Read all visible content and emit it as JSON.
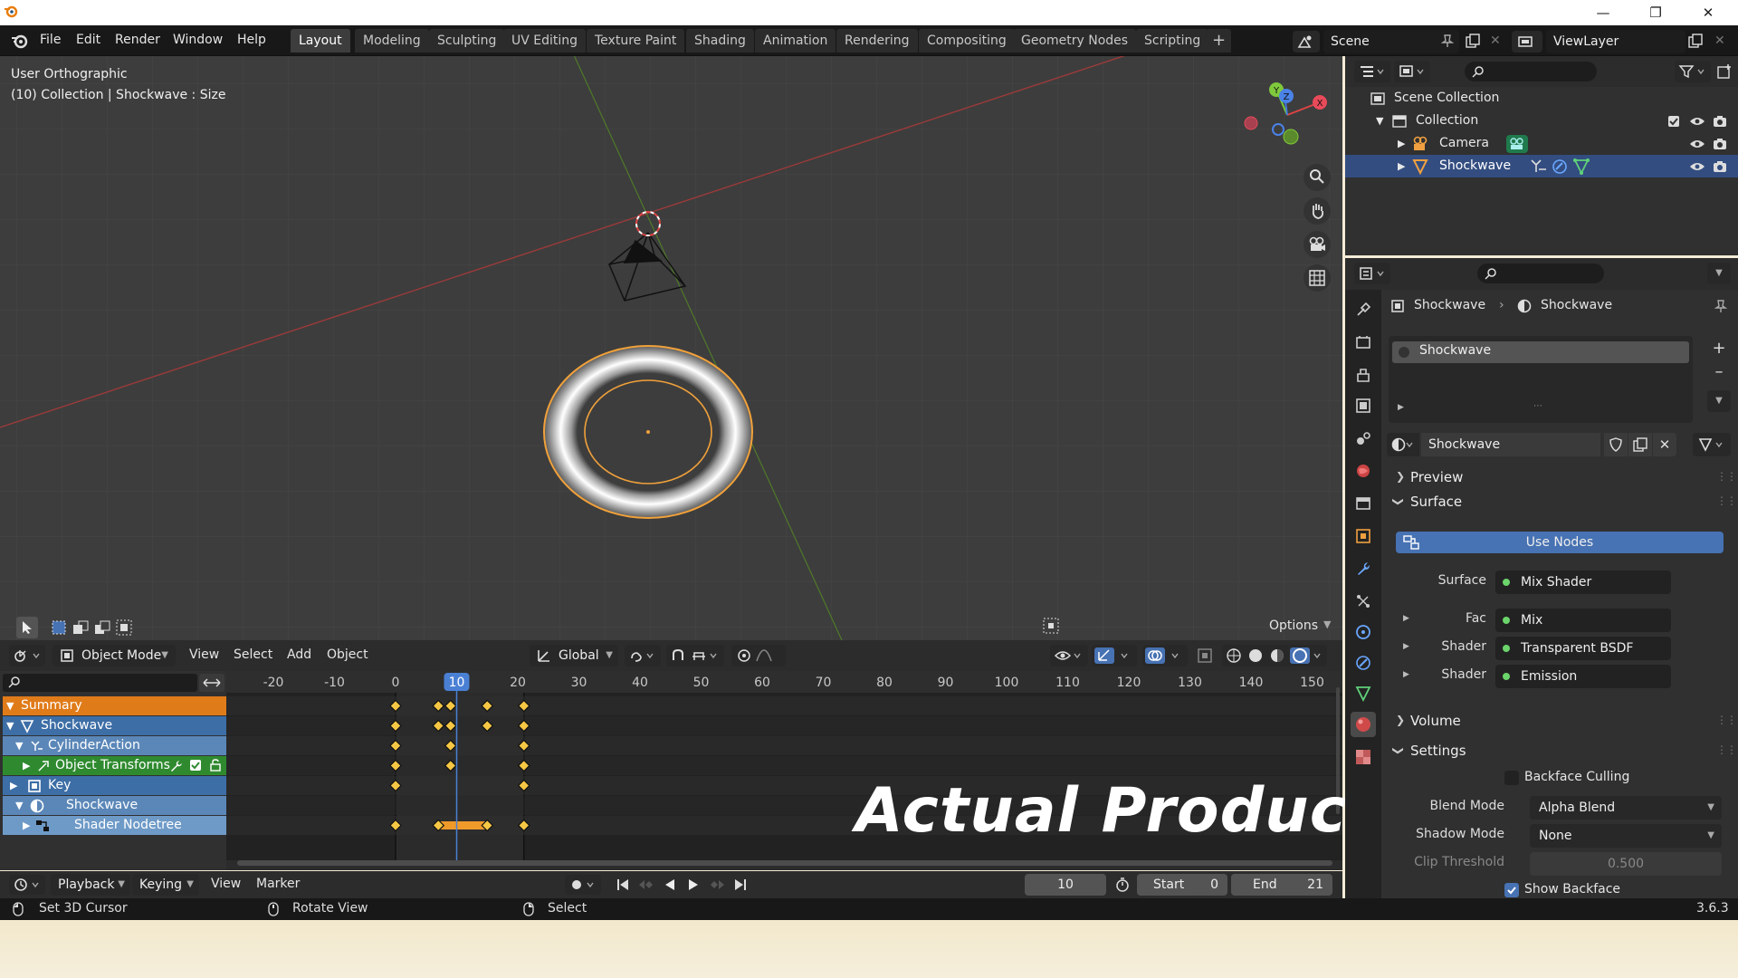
{
  "app": {
    "version": "3.6.3"
  },
  "menu": [
    "File",
    "Edit",
    "Render",
    "Window",
    "Help"
  ],
  "workspaces": [
    "Layout",
    "Modeling",
    "Sculpting",
    "UV Editing",
    "Texture Paint",
    "Shading",
    "Animation",
    "Rendering",
    "Compositing",
    "Geometry Nodes",
    "Scripting"
  ],
  "active_workspace": "Layout",
  "scene": {
    "name": "Scene",
    "view_layer": "ViewLayer"
  },
  "viewport": {
    "view_name": "User Orthographic",
    "context": "(10) Collection | Shockwave : Size",
    "options_label": "Options",
    "gizmo_axes": [
      "X",
      "Y",
      "Z"
    ]
  },
  "viewport_header": {
    "mode": "Object Mode",
    "menus": [
      "View",
      "Select",
      "Add",
      "Object"
    ],
    "orientation": "Global"
  },
  "dopesheet": {
    "ticks": [
      -20,
      -10,
      0,
      10,
      20,
      30,
      40,
      50,
      60,
      70,
      80,
      90,
      100,
      110,
      120,
      130,
      140,
      150
    ],
    "current_frame": 10,
    "channels": [
      {
        "label": "Summary",
        "color": "#e07b1a",
        "indent": 0,
        "key_frames": [
          0,
          7,
          9,
          15,
          21
        ]
      },
      {
        "label": "Shockwave",
        "color": "#3d6ea6",
        "indent": 1,
        "key_frames": [
          0,
          7,
          9,
          15,
          21
        ]
      },
      {
        "label": "CylinderAction",
        "color": "#5b87b8",
        "indent": 2,
        "key_frames": [
          0,
          9,
          21
        ]
      },
      {
        "label": "Object Transforms",
        "color": "#2f8a2f",
        "indent": 3,
        "key_frames": [
          0,
          9,
          21
        ]
      },
      {
        "label": "Key",
        "color": "#3d6ea6",
        "indent": 1,
        "key_frames": [
          0,
          21
        ]
      },
      {
        "label": "Shockwave",
        "color": "#5b87b8",
        "indent": 2,
        "key_frames": []
      },
      {
        "label": "Shader Nodetree",
        "color": "#6e9ac7",
        "indent": 3,
        "key_frames": [
          0,
          7,
          15,
          21
        ]
      }
    ],
    "hold_range": [
      7,
      15
    ]
  },
  "timeline_header": {
    "menus": [
      "Playback",
      "Keying",
      "View",
      "Marker"
    ],
    "frame": "10",
    "start_label": "Start",
    "start": "0",
    "end_label": "End",
    "end": "21"
  },
  "outliner": {
    "items": [
      {
        "label": "Scene Collection"
      },
      {
        "label": "Collection"
      },
      {
        "label": "Camera"
      },
      {
        "label": "Shockwave"
      }
    ]
  },
  "properties": {
    "breadcrumb": [
      "Shockwave",
      "Shockwave"
    ],
    "slot_name": "Shockwave",
    "material_name": "Shockwave",
    "panels": {
      "preview": "Preview",
      "surface": "Surface",
      "use_nodes": "Use Nodes",
      "volume": "Volume",
      "settings": "Settings"
    },
    "surface_rows": [
      {
        "label": "Surface",
        "value": "Mix Shader"
      },
      {
        "label": "Fac",
        "value": "Mix"
      },
      {
        "label": "Shader",
        "value": "Transparent BSDF"
      },
      {
        "label": "Shader",
        "value": "Emission"
      }
    ],
    "settings": {
      "backface_culling": "Backface Culling",
      "blend_mode_label": "Blend Mode",
      "blend_mode": "Alpha Blend",
      "shadow_mode_label": "Shadow Mode",
      "shadow_mode": "None",
      "clip_label": "Clip Threshold",
      "clip_value": "0.500",
      "show_backface": "Show Backface"
    }
  },
  "status": {
    "left": "Set 3D Cursor",
    "middle": "Rotate View",
    "right": "Select"
  },
  "watermark": "Actual Product"
}
